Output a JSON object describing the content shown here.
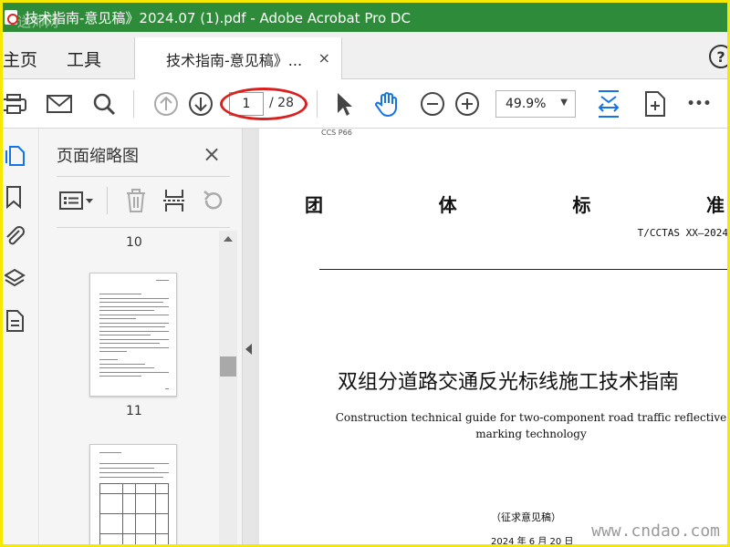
{
  "window": {
    "title": "技术指南-意见稿》2024.07 (1).pdf - Adobe Acrobat Pro DC"
  },
  "tabs": {
    "home": "主页",
    "tools": "工具",
    "document": "技术指南-意见稿》...",
    "close": "×",
    "help": "?"
  },
  "toolbar": {
    "current_page": "1",
    "total_pages": "/ 28",
    "zoom": "49.9%",
    "more": "•••",
    "icons": [
      "print-icon",
      "email-icon",
      "search-icon",
      "previous-page-icon",
      "next-page-icon",
      "select-cursor-icon",
      "hand-tool-icon",
      "zoom-out-icon",
      "zoom-in-icon",
      "fit-page-icon",
      "scrolling-mode-icon",
      "more-icon"
    ]
  },
  "sidebar": {
    "rail_icons": [
      "page-thumbnails-icon",
      "bookmarks-icon",
      "attachments-icon",
      "layers-icon",
      "document-icon"
    ],
    "panel_title": "页面缩略图",
    "close": "×",
    "page_labels": [
      "10",
      "11"
    ]
  },
  "document": {
    "ccs": "CCS   P66",
    "standard_chars": [
      "团",
      "体",
      "标",
      "准"
    ],
    "standard_number": "T/CCTAS XX—2024",
    "title_cn": "双组分道路交通反光标线施工技术指南",
    "title_en": "Construction technical guide for two-component road traffic reflective marking technology",
    "draft_label": "（征求意见稿）",
    "date": "2024 年 6 月 20 日"
  },
  "watermark": {
    "top_left": "送师网",
    "bottom_right": "www.cndao.com"
  },
  "colors": {
    "titlebar": "#2e8b3a",
    "highlight_ellipse": "#d9201f",
    "accent_blue": "#1473e6"
  }
}
